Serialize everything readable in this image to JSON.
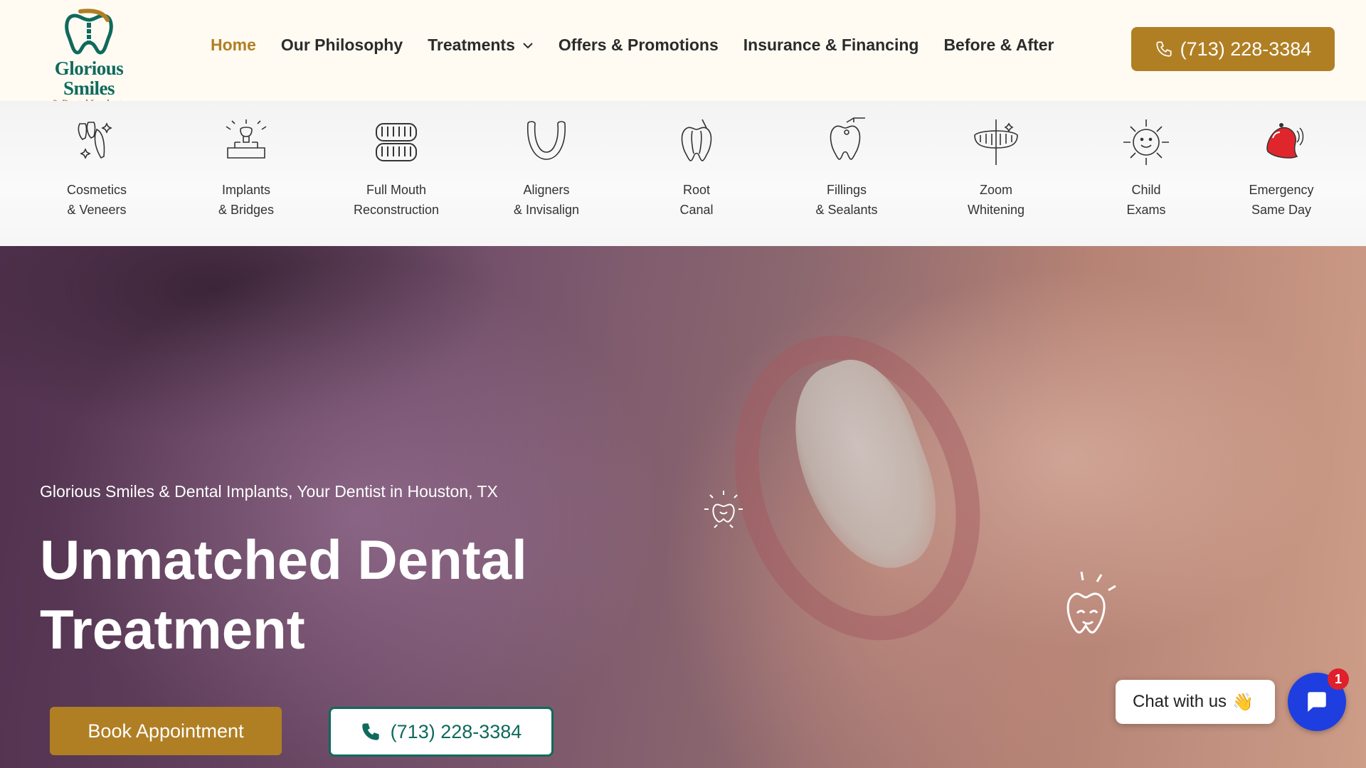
{
  "brand": {
    "name": "Glorious Smiles",
    "tagline": "& Dental Implants",
    "primary_color": "#b07f24",
    "secondary_color": "#0f6a5c"
  },
  "nav": {
    "items": [
      {
        "label": "Home",
        "active": true
      },
      {
        "label": "Our Philosophy",
        "active": false
      },
      {
        "label": "Treatments",
        "active": false,
        "has_dropdown": true
      },
      {
        "label": "Offers & Promotions",
        "active": false
      },
      {
        "label": "Insurance & Financing",
        "active": false
      },
      {
        "label": "Before & After",
        "active": false
      }
    ],
    "phone": "(713) 228-3384"
  },
  "services": [
    {
      "line1": "Cosmetics",
      "line2": "& Veneers",
      "icon": "veneers-icon"
    },
    {
      "line1": "Implants",
      "line2": "& Bridges",
      "icon": "implant-icon"
    },
    {
      "line1": "Full Mouth",
      "line2": "Reconstruction",
      "icon": "dentures-icon"
    },
    {
      "line1": "Aligners",
      "line2": "& Invisalign",
      "icon": "aligner-icon"
    },
    {
      "line1": "Root",
      "line2": "Canal",
      "icon": "root-canal-icon"
    },
    {
      "line1": "Fillings",
      "line2": "& Sealants",
      "icon": "filling-icon"
    },
    {
      "line1": "Zoom",
      "line2": "Whitening",
      "icon": "whitening-icon"
    },
    {
      "line1": "Child",
      "line2": "Exams",
      "icon": "child-tooth-icon"
    },
    {
      "line1": "Emergency",
      "line2": "Same Day",
      "icon": "emergency-bell-icon"
    }
  ],
  "hero": {
    "subtitle": "Glorious Smiles & Dental Implants, Your Dentist in Houston, TX",
    "title_line1": "Unmatched Dental",
    "title_line2": "Treatment",
    "book_label": "Book Appointment",
    "phone": "(713) 228-3384"
  },
  "chat": {
    "label": "Chat with us",
    "emoji": "👋",
    "badge_count": "1"
  }
}
